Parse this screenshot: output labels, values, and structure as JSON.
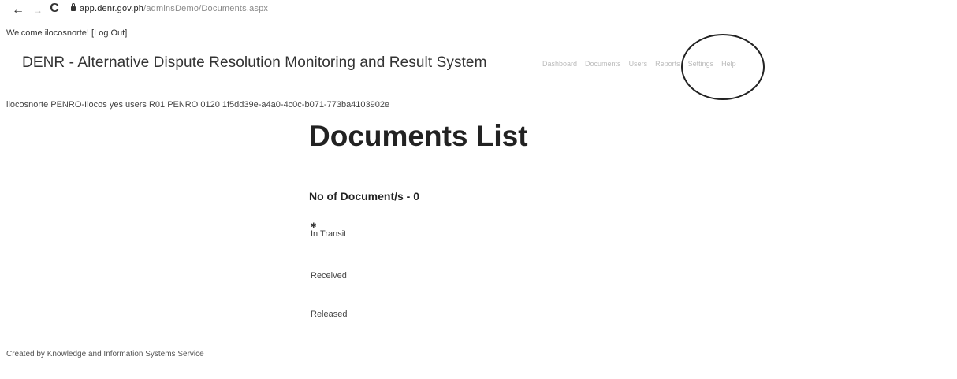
{
  "browser": {
    "back": "←",
    "forward": "→",
    "reload": "C",
    "url_domain": "app.denr.gov.ph",
    "url_path": "/adminsDemo/Documents.aspx"
  },
  "header": {
    "welcome_text": "Welcome ilocosnorte! [",
    "logout_label": "Log Out",
    "welcome_close": "]",
    "site_title": "DENR - Alternative Dispute Resolution Monitoring and Result System",
    "nav_items": [
      "Dashboard",
      "Documents",
      "Users",
      "Reports",
      "Settings",
      "Help"
    ]
  },
  "user_info": "ilocosnorte PENRO-Ilocos yes users R01 PENRO 0120 1f5dd39e-a4a0-4c0c-b071-773ba4103902e",
  "main": {
    "title": "Documents List",
    "doc_count": "No of Document/s - 0",
    "status_icon": "✱",
    "statuses": [
      "In Transit",
      "Received",
      "Released"
    ]
  },
  "footer": "Created by Knowledge and Information Systems Service"
}
